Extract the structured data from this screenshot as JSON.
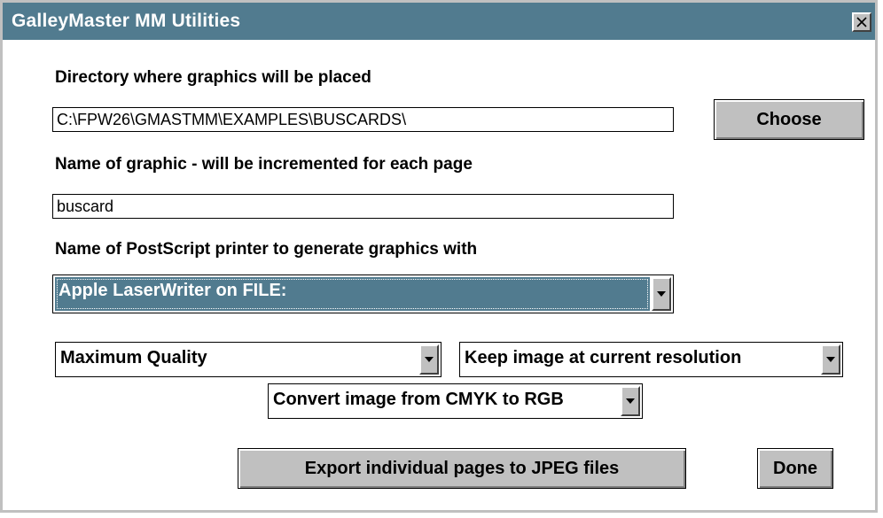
{
  "window": {
    "title": "GalleyMaster MM Utilities",
    "close_icon": "close-icon"
  },
  "directory": {
    "label": "Directory where graphics will be placed",
    "value": "C:\\FPW26\\GMASTMM\\EXAMPLES\\BUSCARDS\\",
    "choose_label": "Choose"
  },
  "graphic_name": {
    "label": "Name of graphic - will be incremented for each page",
    "value": "buscard"
  },
  "printer": {
    "label": "Name of PostScript printer to generate graphics with",
    "selected": "Apple LaserWriter on FILE:"
  },
  "options": {
    "quality": "Maximum Quality",
    "resolution": "Keep image at current resolution",
    "color_conversion": "Convert image from CMYK to RGB"
  },
  "actions": {
    "export_label": "Export individual pages to JPEG files",
    "done_label": "Done"
  },
  "colors": {
    "titlebar": "#517b8f",
    "button_face": "#c0c0c0",
    "selection": "#517b8f"
  }
}
